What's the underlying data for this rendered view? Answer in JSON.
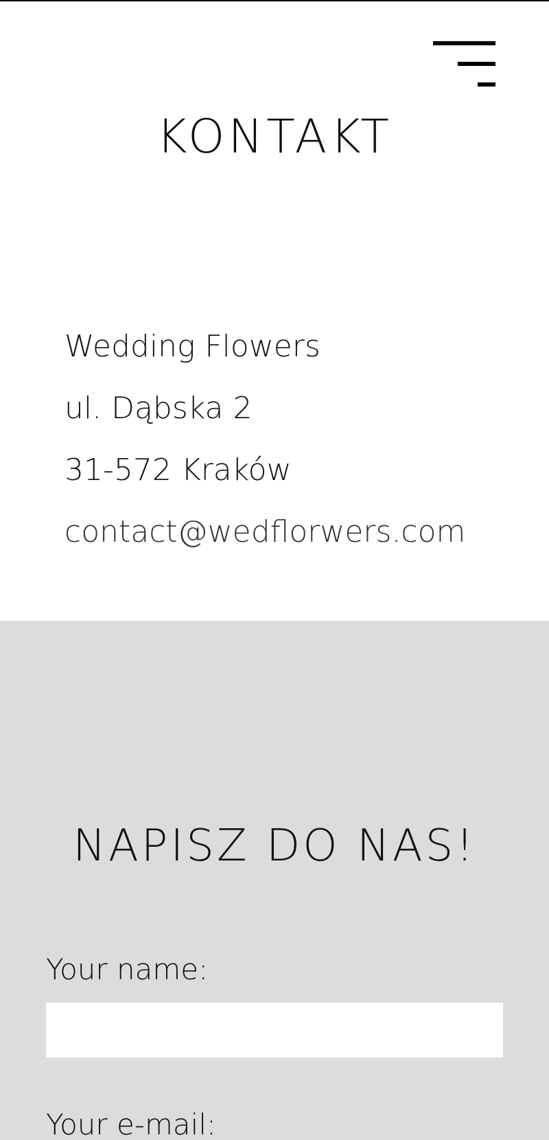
{
  "header": {
    "menu_icon": "hamburger-menu-icon"
  },
  "contact": {
    "title": "KONTAKT",
    "company": "Wedding Flowers",
    "street": "ul. Dąbska 2",
    "city": "31-572 Kraków",
    "email": "contact@wedflorwers.com"
  },
  "form": {
    "title": "NAPISZ DO NAS!",
    "name_label": "Your name:",
    "name_value": "",
    "email_label": "Your e-mail:"
  },
  "colors": {
    "form_background": "#dcdcdc",
    "text": "#111111",
    "input_background": "#ffffff"
  }
}
